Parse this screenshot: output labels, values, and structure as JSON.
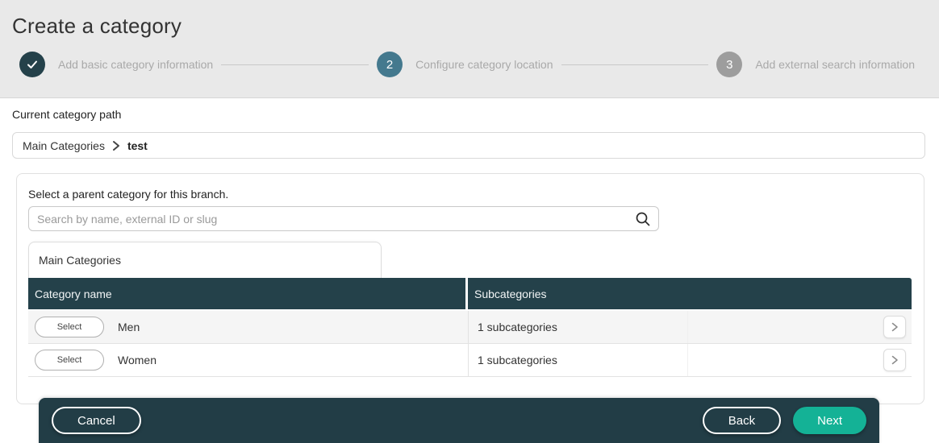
{
  "page": {
    "title": "Create a category"
  },
  "stepper": {
    "steps": [
      {
        "indicator": "check",
        "label": "Add basic category information",
        "state": "completed"
      },
      {
        "indicator": "2",
        "label": "Configure category location",
        "state": "active"
      },
      {
        "indicator": "3",
        "label": "Add external search information",
        "state": "upcoming"
      }
    ]
  },
  "path_section": {
    "label": "Current category path",
    "breadcrumb": {
      "root": "Main Categories",
      "current": "test"
    }
  },
  "parent_selector": {
    "instruction": "Select a parent category for this branch.",
    "search": {
      "placeholder": "Search by name, external ID or slug"
    },
    "tab": "Main Categories",
    "table": {
      "columns": [
        "Category name",
        "Subcategories"
      ],
      "rows": [
        {
          "select_label": "Select",
          "name": "Men",
          "subcategories": "1 subcategories"
        },
        {
          "select_label": "Select",
          "name": "Women",
          "subcategories": "1 subcategories"
        }
      ]
    }
  },
  "footer": {
    "cancel_label": "Cancel",
    "back_label": "Back",
    "next_label": "Next"
  },
  "icons": {
    "step_complete": "check",
    "breadcrumb_separator": "chevron-right",
    "search": "magnifier",
    "row_expand": "chevron-right"
  },
  "colors": {
    "header_background": "#e9e9e9",
    "dark_teal": "#24414a",
    "active_step_teal": "#44798e",
    "inactive_step_gray": "#9d9d9d",
    "next_button_green": "#14b296",
    "row_alt_background": "#f5f5f5"
  }
}
